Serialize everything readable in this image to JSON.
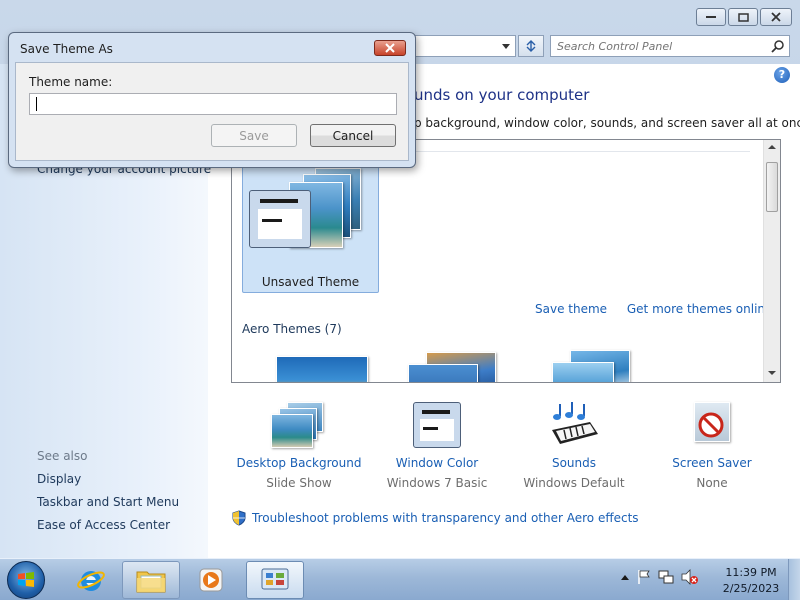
{
  "window": {
    "search_placeholder": "Search Control Panel",
    "help_glyph": "?"
  },
  "left_pane": {
    "partial_link": "Change your account picture",
    "see_also_label": "See also",
    "see_also_links": [
      "Display",
      "Taskbar and Start Menu",
      "Ease of Access Center"
    ]
  },
  "main": {
    "heading_partial": "unds on your computer",
    "subheading_partial": "p background, window color, sounds, and screen saver all at once.",
    "unsaved_theme_label": "Unsaved Theme",
    "save_theme_link": "Save theme",
    "get_more_link": "Get more themes online",
    "aero_heading": "Aero Themes (7)"
  },
  "bottom_items": [
    {
      "title": "Desktop Background",
      "subtitle": "Slide Show"
    },
    {
      "title": "Window Color",
      "subtitle": "Windows 7 Basic"
    },
    {
      "title": "Sounds",
      "subtitle": "Windows Default"
    },
    {
      "title": "Screen Saver",
      "subtitle": "None"
    }
  ],
  "troubleshoot_link": "Troubleshoot problems with transparency and other Aero effects",
  "dialog": {
    "title": "Save Theme As",
    "field_label": "Theme name:",
    "field_value": "",
    "save_label": "Save",
    "cancel_label": "Cancel"
  },
  "taskbar": {
    "time": "11:39 PM",
    "date": "2/25/2023"
  }
}
